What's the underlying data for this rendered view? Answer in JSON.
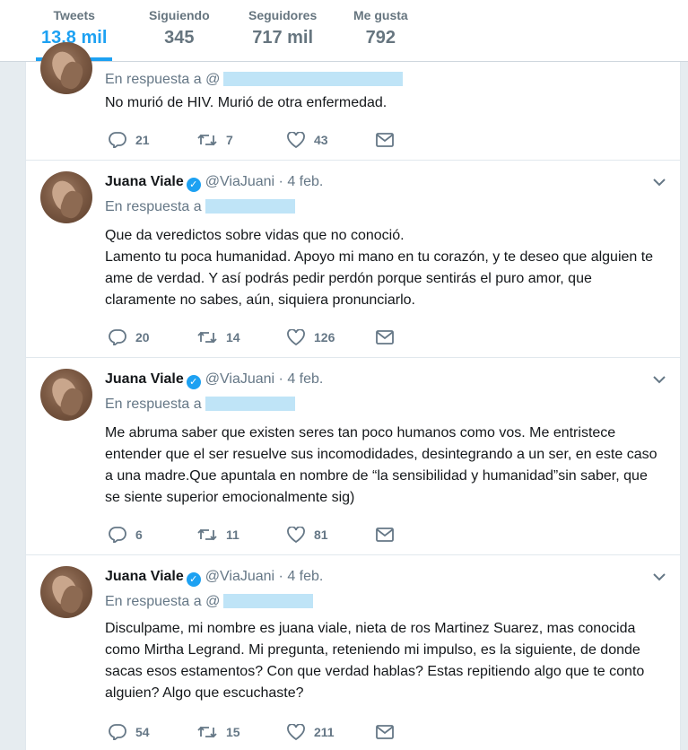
{
  "profile_nav": {
    "stats": [
      {
        "label": "Tweets",
        "value": "13,8 mil"
      },
      {
        "label": "Siguiendo",
        "value": "345"
      },
      {
        "label": "Seguidores",
        "value": "717 mil"
      },
      {
        "label": "Me gusta",
        "value": "792"
      }
    ]
  },
  "colors": {
    "accent": "#1da1f2",
    "redaction": "#bfe4f7"
  },
  "tweets": [
    {
      "reply_prefix": "En respuesta a",
      "reply_handle_visible": "@",
      "body": [
        "No murió de HIV. Murió de otra enfermedad."
      ],
      "replies": "21",
      "retweets": "7",
      "likes": "43"
    },
    {
      "name": "Juana Viale",
      "handle": "@ViaJuani",
      "date": "· 4 feb.",
      "reply_prefix": "En respuesta a",
      "body": [
        "Que da veredictos sobre vidas que no conoció.",
        "Lamento tu poca humanidad. Apoyo mi mano en tu corazón, y te deseo que alguien te ame de verdad. Y así podrás pedir perdón porque sentirás el puro amor, que claramente no sabes, aún, siquiera pronunciarlo."
      ],
      "replies": "20",
      "retweets": "14",
      "likes": "126"
    },
    {
      "name": "Juana Viale",
      "handle": "@ViaJuani",
      "date": "· 4 feb.",
      "reply_prefix": "En respuesta a",
      "body": [
        "Me abruma saber que existen seres tan poco humanos como vos. Me entristece entender que el ser resuelve sus incomodidades, desintegrando a un ser, en este caso a una madre.Que apuntala en nombre de “la sensibilidad y humanidad”sin saber, que se siente superior emocionalmente sig)"
      ],
      "replies": "6",
      "retweets": "11",
      "likes": "81"
    },
    {
      "name": "Juana Viale",
      "handle": "@ViaJuani",
      "date": "· 4 feb.",
      "reply_prefix": "En respuesta a",
      "reply_handle_visible": "@",
      "body": [
        "Disculpame, mi nombre es juana viale, nieta de ros Martinez Suarez, mas conocida como Mirtha Legrand. Mi pregunta, reteniendo mi impulso, es la siguiente, de donde sacas esos estamentos? Con que verdad hablas? Estas repitiendo algo que te conto alguien? Algo que escuchaste?"
      ],
      "replies": "54",
      "retweets": "15",
      "likes": "211"
    }
  ]
}
